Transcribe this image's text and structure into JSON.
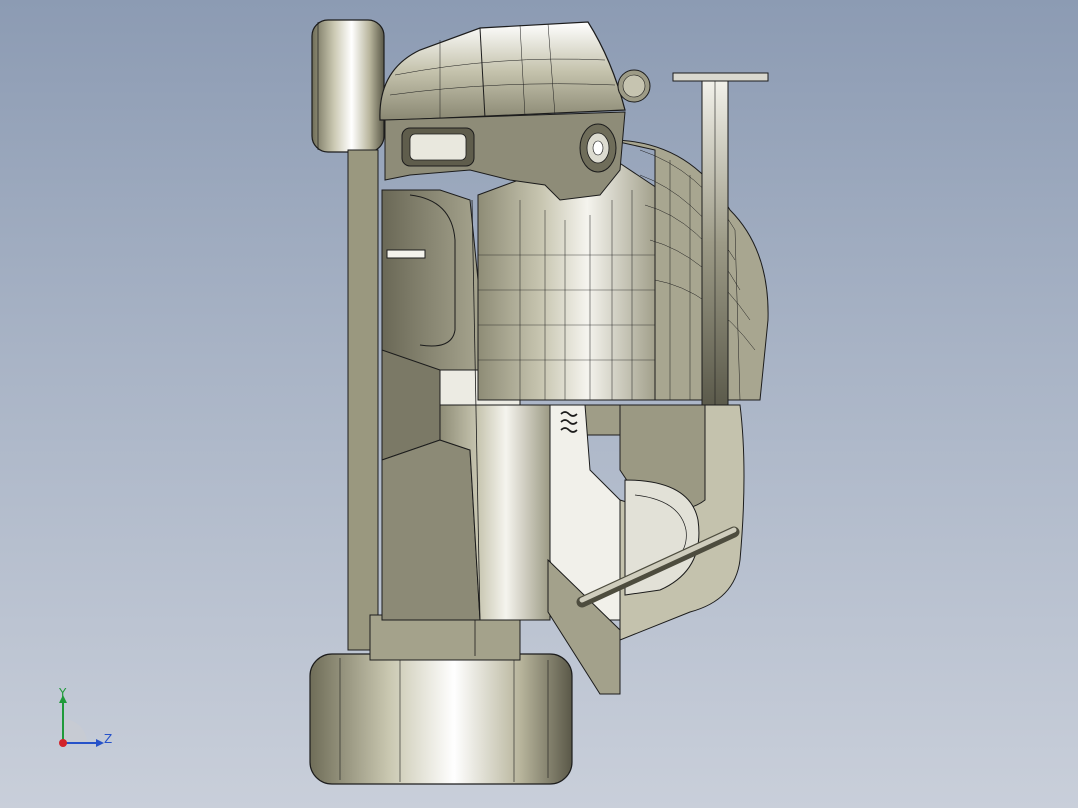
{
  "viewport": {
    "background_top": "#8c9bb3",
    "background_bottom": "#c9cfda"
  },
  "model": {
    "shell_color": "#b8b59c",
    "edge_color": "#1c1c1c",
    "highlight_color": "#f4f3ec"
  },
  "triad": {
    "y_label": "Y",
    "z_label": "Z",
    "y_color": "#1f9a3a",
    "z_color": "#2652c9",
    "x_color": "#d2232a"
  }
}
